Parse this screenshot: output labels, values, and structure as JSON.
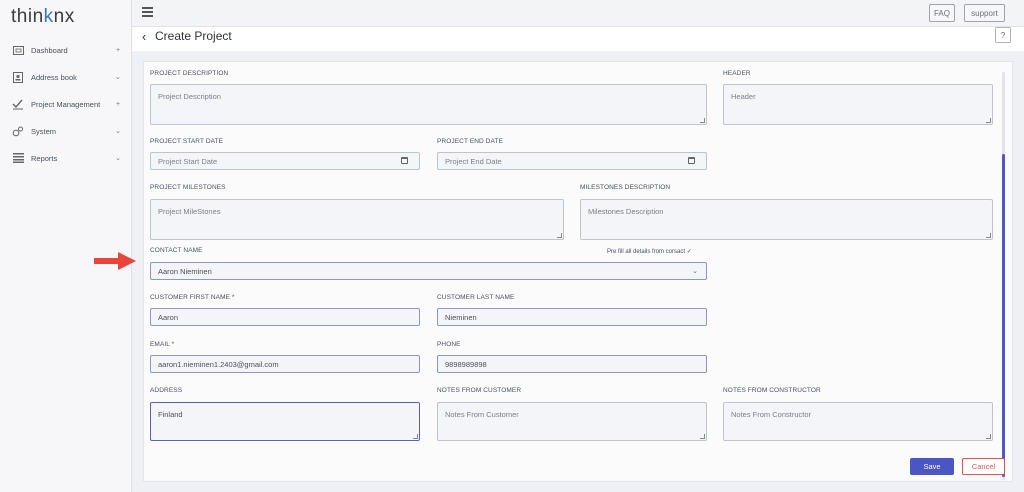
{
  "app": {
    "logo_prefix": "thin",
    "logo_accent": "k",
    "logo_suffix": "nx"
  },
  "sidebar": {
    "items": [
      {
        "label": "Dashboard",
        "icon": "dashboard-icon",
        "trail": "+"
      },
      {
        "label": "Address book",
        "icon": "address-book-icon",
        "trail": "⌄"
      },
      {
        "label": "Project Management",
        "icon": "project-management-icon",
        "trail": "+"
      },
      {
        "label": "System",
        "icon": "system-icon",
        "trail": "⌄"
      },
      {
        "label": "Reports",
        "icon": "reports-icon",
        "trail": "⌄"
      }
    ]
  },
  "topbar": {
    "faq_label": "FAQ",
    "support_label": "support"
  },
  "page": {
    "title": "Create Project",
    "help_label": "?"
  },
  "form": {
    "project_description": {
      "label": "PROJECT DESCRIPTION",
      "placeholder": "Project Description"
    },
    "header": {
      "label": "HEADER",
      "placeholder": "Header"
    },
    "start_date": {
      "label": "PROJECT START DATE",
      "placeholder": "Project Start Date"
    },
    "end_date": {
      "label": "PROJECT END DATE",
      "placeholder": "Project End Date"
    },
    "milestones": {
      "label": "PROJECT MILESTONES",
      "placeholder": "Project MileStones"
    },
    "milestones_description": {
      "label": "MILESTONES DESCRIPTION",
      "placeholder": "Milestones Description"
    },
    "contact_name": {
      "label": "CONTACT NAME",
      "value": "Aaron Nieminen",
      "prefill": "Pre fill all details from corsact ✓"
    },
    "first_name": {
      "label": "CUSTOMER FIRST NAME *",
      "value": "Aaron"
    },
    "last_name": {
      "label": "CUSTOMER LAST NAME",
      "value": "Nieminen"
    },
    "email": {
      "label": "EMAIL *",
      "value": "aaron1.nieminen1.2403@gmail.com"
    },
    "phone": {
      "label": "PHONE",
      "value": "9898989898"
    },
    "address": {
      "label": "ADDRESS",
      "value": "Finland"
    },
    "notes_customer": {
      "label": "NOTES FROM CUSTOMER",
      "placeholder": "Notes From Customer"
    },
    "notes_constructor": {
      "label": "NOTES FROM CONSTRUCTOR",
      "placeholder": "Notes From Constructor"
    }
  },
  "actions": {
    "save_label": "Save",
    "cancel_label": "Cancel"
  },
  "colors": {
    "accent": "#4b55c4",
    "danger": "#e35252",
    "arrow": "#e8453c"
  }
}
